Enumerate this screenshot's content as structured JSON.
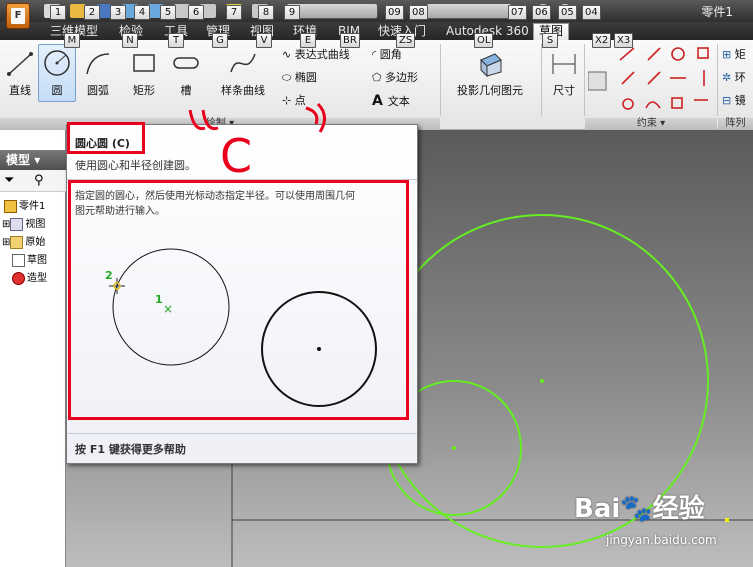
{
  "window": {
    "title": "零件1"
  },
  "app_button": {
    "label": "F"
  },
  "tabs": [
    {
      "label": "三维模型"
    },
    {
      "label": "检验"
    },
    {
      "label": "工具"
    },
    {
      "label": "管理"
    },
    {
      "label": "视图"
    },
    {
      "label": "环境"
    },
    {
      "label": "BIM"
    },
    {
      "label": "快速入门"
    },
    {
      "label": "Autodesk 360"
    },
    {
      "label": "草图"
    }
  ],
  "keytips": [
    "1",
    "2",
    "3",
    "4",
    "5",
    "6",
    "7",
    "8",
    "9",
    "09",
    "08",
    "07",
    "06",
    "05",
    "04",
    "M",
    "N",
    "T",
    "G",
    "V",
    "E",
    "BR",
    "ZS",
    "OL",
    "S",
    "X2",
    "X3"
  ],
  "ribbon": {
    "line": "直线",
    "circle": "圆",
    "arc": "圆弧",
    "rectangle": "矩形",
    "slot": "槽",
    "spline": "样条曲线",
    "equation_curve": "表达式曲线",
    "ellipse": "椭圆",
    "point": "点",
    "fillet": "圆角",
    "polygon": "多边形",
    "text": "文本",
    "project_geometry": "投影几何图元",
    "dimension": "尺寸",
    "draw_panel": "绘制",
    "constrain_panel": "约束",
    "array_panel": "阵列",
    "right_short": {
      "rect": "矩",
      "ring": "环",
      "mirror": "镜"
    }
  },
  "model_panel": {
    "title": "模型",
    "tree": [
      {
        "label": "零件1"
      },
      {
        "label": "视图"
      },
      {
        "label": "原始"
      },
      {
        "label": "草图"
      },
      {
        "label": "造型"
      }
    ]
  },
  "tooltip": {
    "title": "圆心圆 (C)",
    "description": "使用圆心和半径创建圆。",
    "body_line1": "指定圆的圆心，然后使用光标动态指定半径。可以使用周围几何",
    "body_line2": "图元帮助进行输入。",
    "marker_center": "1",
    "marker_radius": "2",
    "help": "按 F1 键获得更多帮助"
  },
  "annotation": {
    "handwriting": "C"
  },
  "watermark": {
    "brand": "Bai",
    "brand2": "经验",
    "url": "jingyan.baidu.com"
  },
  "colors": {
    "sketch_green": "#66ee22",
    "highlight_red": "#e8001c"
  }
}
